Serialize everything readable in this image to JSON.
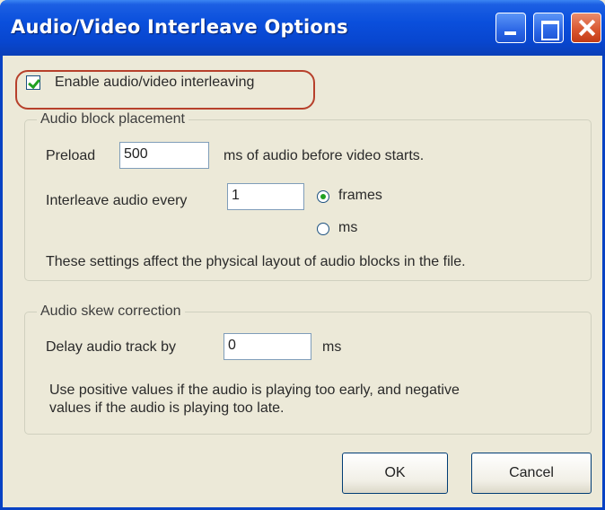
{
  "window": {
    "title": "Audio/Video Interleave Options"
  },
  "enable": {
    "label": "Enable audio/video interleaving",
    "checked": true
  },
  "placement": {
    "title": "Audio block placement",
    "preload_label": "Preload",
    "preload_value": "500",
    "preload_suffix": "ms of audio before video starts.",
    "interleave_label": "Interleave audio every",
    "interleave_value": "1",
    "unit_frames": "frames",
    "unit_ms": "ms",
    "selected_unit": "frames",
    "note": "These settings affect the physical layout of audio blocks in the file."
  },
  "skew": {
    "title": "Audio skew correction",
    "delay_label": "Delay audio track by",
    "delay_value": "0",
    "delay_suffix": "ms",
    "note_line1": "Use positive values if the audio is playing too early, and negative",
    "note_line2": "values if the audio is playing too late."
  },
  "buttons": {
    "ok": "OK",
    "cancel": "Cancel"
  }
}
